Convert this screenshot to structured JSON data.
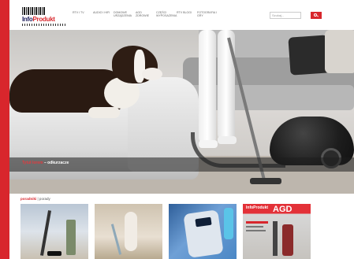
{
  "header": {
    "logo_brand_part1": "Info",
    "logo_brand_part2": "Produkt",
    "nav": [
      "RTV i TV",
      "AUDIO i HIFI",
      "DOMOWE URZĄDZENIA",
      "AGD ZDROWIE",
      "CZĘŚCI WYPOSAŻENIA",
      "RTV BLOGI",
      "FOTOGRAFIA i GRY"
    ],
    "search_placeholder": "Szukaj..."
  },
  "hero": {
    "caption_highlight": "Tytuł lorem",
    "caption_text": " – odkurzacze"
  },
  "section": {
    "label_highlight": "poradniki",
    "label_rest": " | porady"
  },
  "thumbs": [
    {
      "name": "stick-vacuum"
    },
    {
      "name": "mopping"
    },
    {
      "name": "bathroom-scale"
    },
    {
      "name": "magazine-cover",
      "brand": "InfoProdukt",
      "title": "AGD"
    }
  ],
  "colors": {
    "accent": "#d8262c",
    "brand_dark": "#1b1b5a"
  }
}
